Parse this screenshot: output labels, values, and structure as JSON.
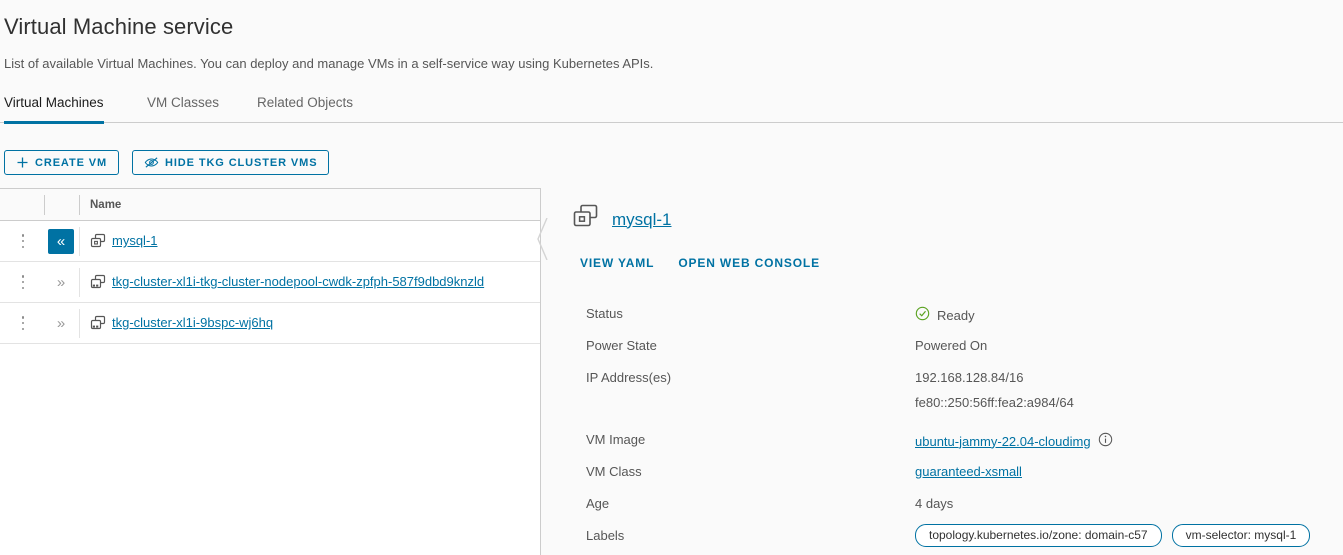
{
  "header": {
    "title": "Virtual Machine service",
    "description": "List of available Virtual Machines. You can deploy and manage VMs in a self-service way using Kubernetes APIs."
  },
  "tabs": [
    {
      "label": "Virtual Machines",
      "active": true
    },
    {
      "label": "VM Classes",
      "active": false
    },
    {
      "label": "Related Objects",
      "active": false
    }
  ],
  "toolbar": {
    "create_label": "CREATE VM",
    "create_icon": "plus-icon",
    "hide_label": "HIDE TKG CLUSTER VMS",
    "hide_icon": "eye-slash-icon"
  },
  "table": {
    "columns": [
      "",
      "",
      "Name"
    ],
    "rows": [
      {
        "name": "mysql-1",
        "selected": true,
        "expander": "«",
        "icon": "vm-icon"
      },
      {
        "name": "tkg-cluster-xl1i-tkg-cluster-nodepool-cwdk-zpfph-587f9dbd9knzld",
        "selected": false,
        "expander": "»",
        "icon": "vm-cluster-icon"
      },
      {
        "name": "tkg-cluster-xl1i-9bspc-wj6hq",
        "selected": false,
        "expander": "»",
        "icon": "vm-cluster-icon"
      }
    ]
  },
  "detail": {
    "name": "mysql-1",
    "icon": "vm-icon",
    "links": [
      {
        "label": "VIEW YAML"
      },
      {
        "label": "OPEN WEB CONSOLE"
      }
    ],
    "fields": {
      "status_label": "Status",
      "status_value": "Ready",
      "status_icon": "check-circle-icon",
      "power_label": "Power State",
      "power_value": "Powered On",
      "ip_label": "IP Address(es)",
      "ip_v4": "192.168.128.84/16",
      "ip_v6": "fe80::250:56ff:fea2:a984/64",
      "image_label": "VM Image",
      "image_value": "ubuntu-jammy-22.04-cloudimg",
      "image_info_icon": "info-icon",
      "class_label": "VM Class",
      "class_value": "guaranteed-xsmall",
      "age_label": "Age",
      "age_value": "4 days",
      "labels_label": "Labels",
      "labels": [
        "topology.kubernetes.io/zone: domain-c57",
        "vm-selector: mysql-1"
      ]
    }
  },
  "colors": {
    "accent": "#0072a3",
    "status_green": "#5aa220",
    "text": "#313131",
    "muted": "#565656",
    "border": "#cccccc",
    "background": "#fafafa",
    "panel": "#ffffff"
  }
}
